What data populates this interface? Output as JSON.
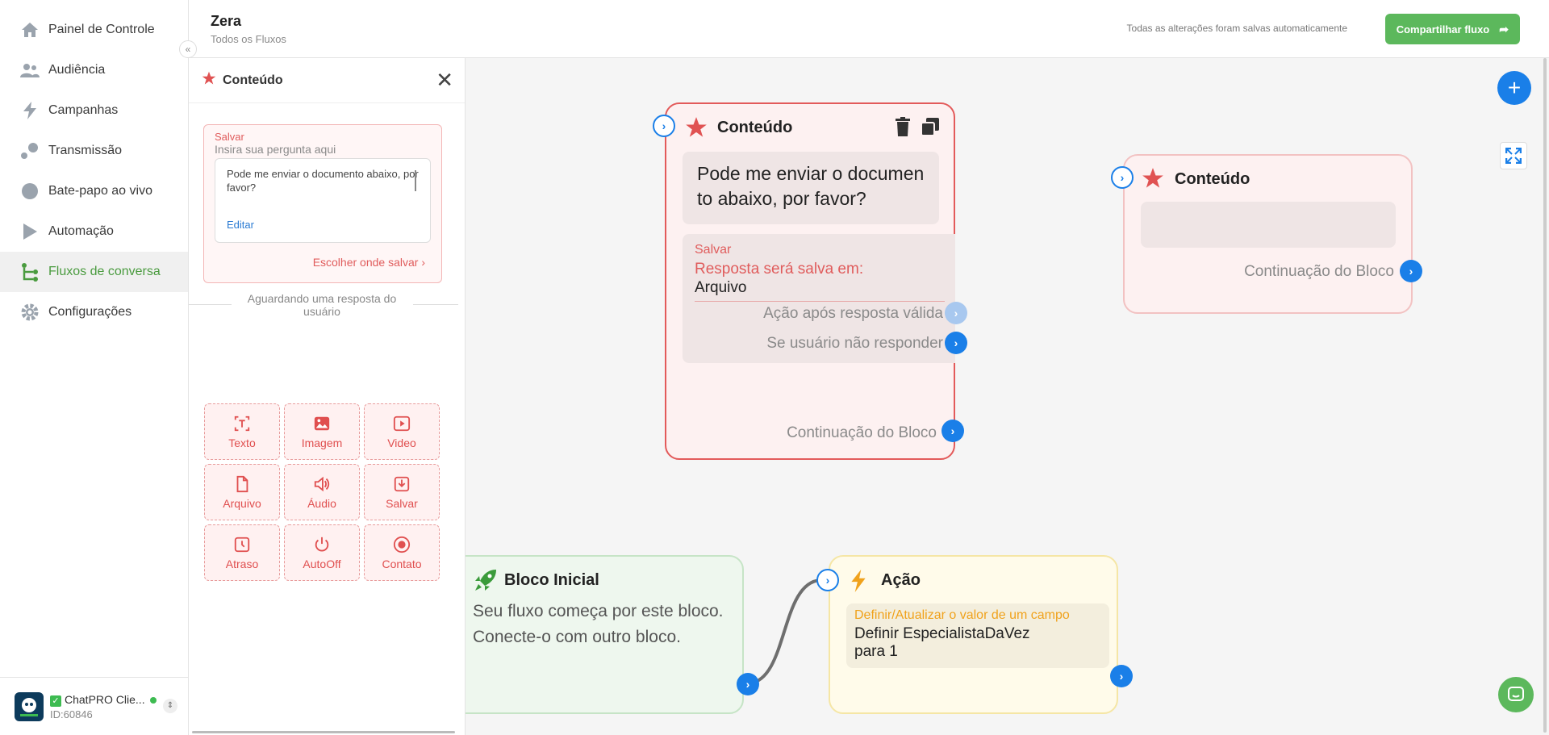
{
  "nav": {
    "items": [
      {
        "label": "Painel de Controle",
        "icon": "home-icon"
      },
      {
        "label": "Audiência",
        "icon": "users-icon"
      },
      {
        "label": "Campanhas",
        "icon": "bolt-icon"
      },
      {
        "label": "Transmissão",
        "icon": "broadcast-icon"
      },
      {
        "label": "Bate-papo ao vivo",
        "icon": "chat-icon"
      },
      {
        "label": "Automação",
        "icon": "play-icon"
      },
      {
        "label": "Fluxos de conversa",
        "icon": "flow-icon"
      },
      {
        "label": "Configurações",
        "icon": "gear-icon"
      }
    ],
    "active_index": 6
  },
  "account": {
    "name": "ChatPRO Clie...",
    "id": "ID:60846",
    "logo_text": "ChatPRO"
  },
  "header": {
    "flow_name": "Zera",
    "breadcrumb": "Todos os Fluxos",
    "saved_status": "Todas as alterações foram salvas automaticamente",
    "share_label": "Compartilhar fluxo"
  },
  "panel": {
    "title": "Conteúdo",
    "save_label": "Salvar",
    "save_hint": "Insira sua pergunta aqui",
    "question": "Pode me enviar o documento abaixo, por favor?",
    "edit_label": "Editar",
    "choose_where": "Escolher onde salvar",
    "waiting": "Aguardando uma resposta do usuário",
    "buttons": [
      {
        "label": "Texto",
        "icon": "text-icon"
      },
      {
        "label": "Imagem",
        "icon": "image-icon"
      },
      {
        "label": "Video",
        "icon": "video-icon"
      },
      {
        "label": "Arquivo",
        "icon": "file-icon"
      },
      {
        "label": "Áudio",
        "icon": "audio-icon"
      },
      {
        "label": "Salvar",
        "icon": "download-icon"
      },
      {
        "label": "Atraso",
        "icon": "clock-icon"
      },
      {
        "label": "AutoOff",
        "icon": "power-icon"
      },
      {
        "label": "Contato",
        "icon": "contact-icon"
      }
    ]
  },
  "canvas": {
    "content_node_1": {
      "title": "Conteúdo",
      "message": "Pode me enviar o documen to abaixo, por favor?",
      "save_label": "Salvar",
      "saved_in_label": "Resposta será salva em:",
      "saved_in_value": "Arquivo",
      "action_valid": "Ação após resposta válida",
      "no_reply": "Se usuário não responder",
      "continuation": "Continuação do Bloco"
    },
    "content_node_2": {
      "title": "Conteúdo",
      "continuation": "Continuação do Bloco"
    },
    "start_node": {
      "title": "Bloco Inicial",
      "line1": "Seu fluxo começa por este bloco.",
      "line2": "Conecte-o com outro bloco."
    },
    "action_node": {
      "title": "Ação",
      "action_label": "Definir/Atualizar o valor de um campo",
      "action_line1": "Definir EspecialistaDaVez",
      "action_line2": "para 1"
    }
  },
  "colors": {
    "primary": "#1a7fe8",
    "green": "#5cb85c",
    "red": "#e05c5c",
    "amber": "#f0a21c"
  }
}
